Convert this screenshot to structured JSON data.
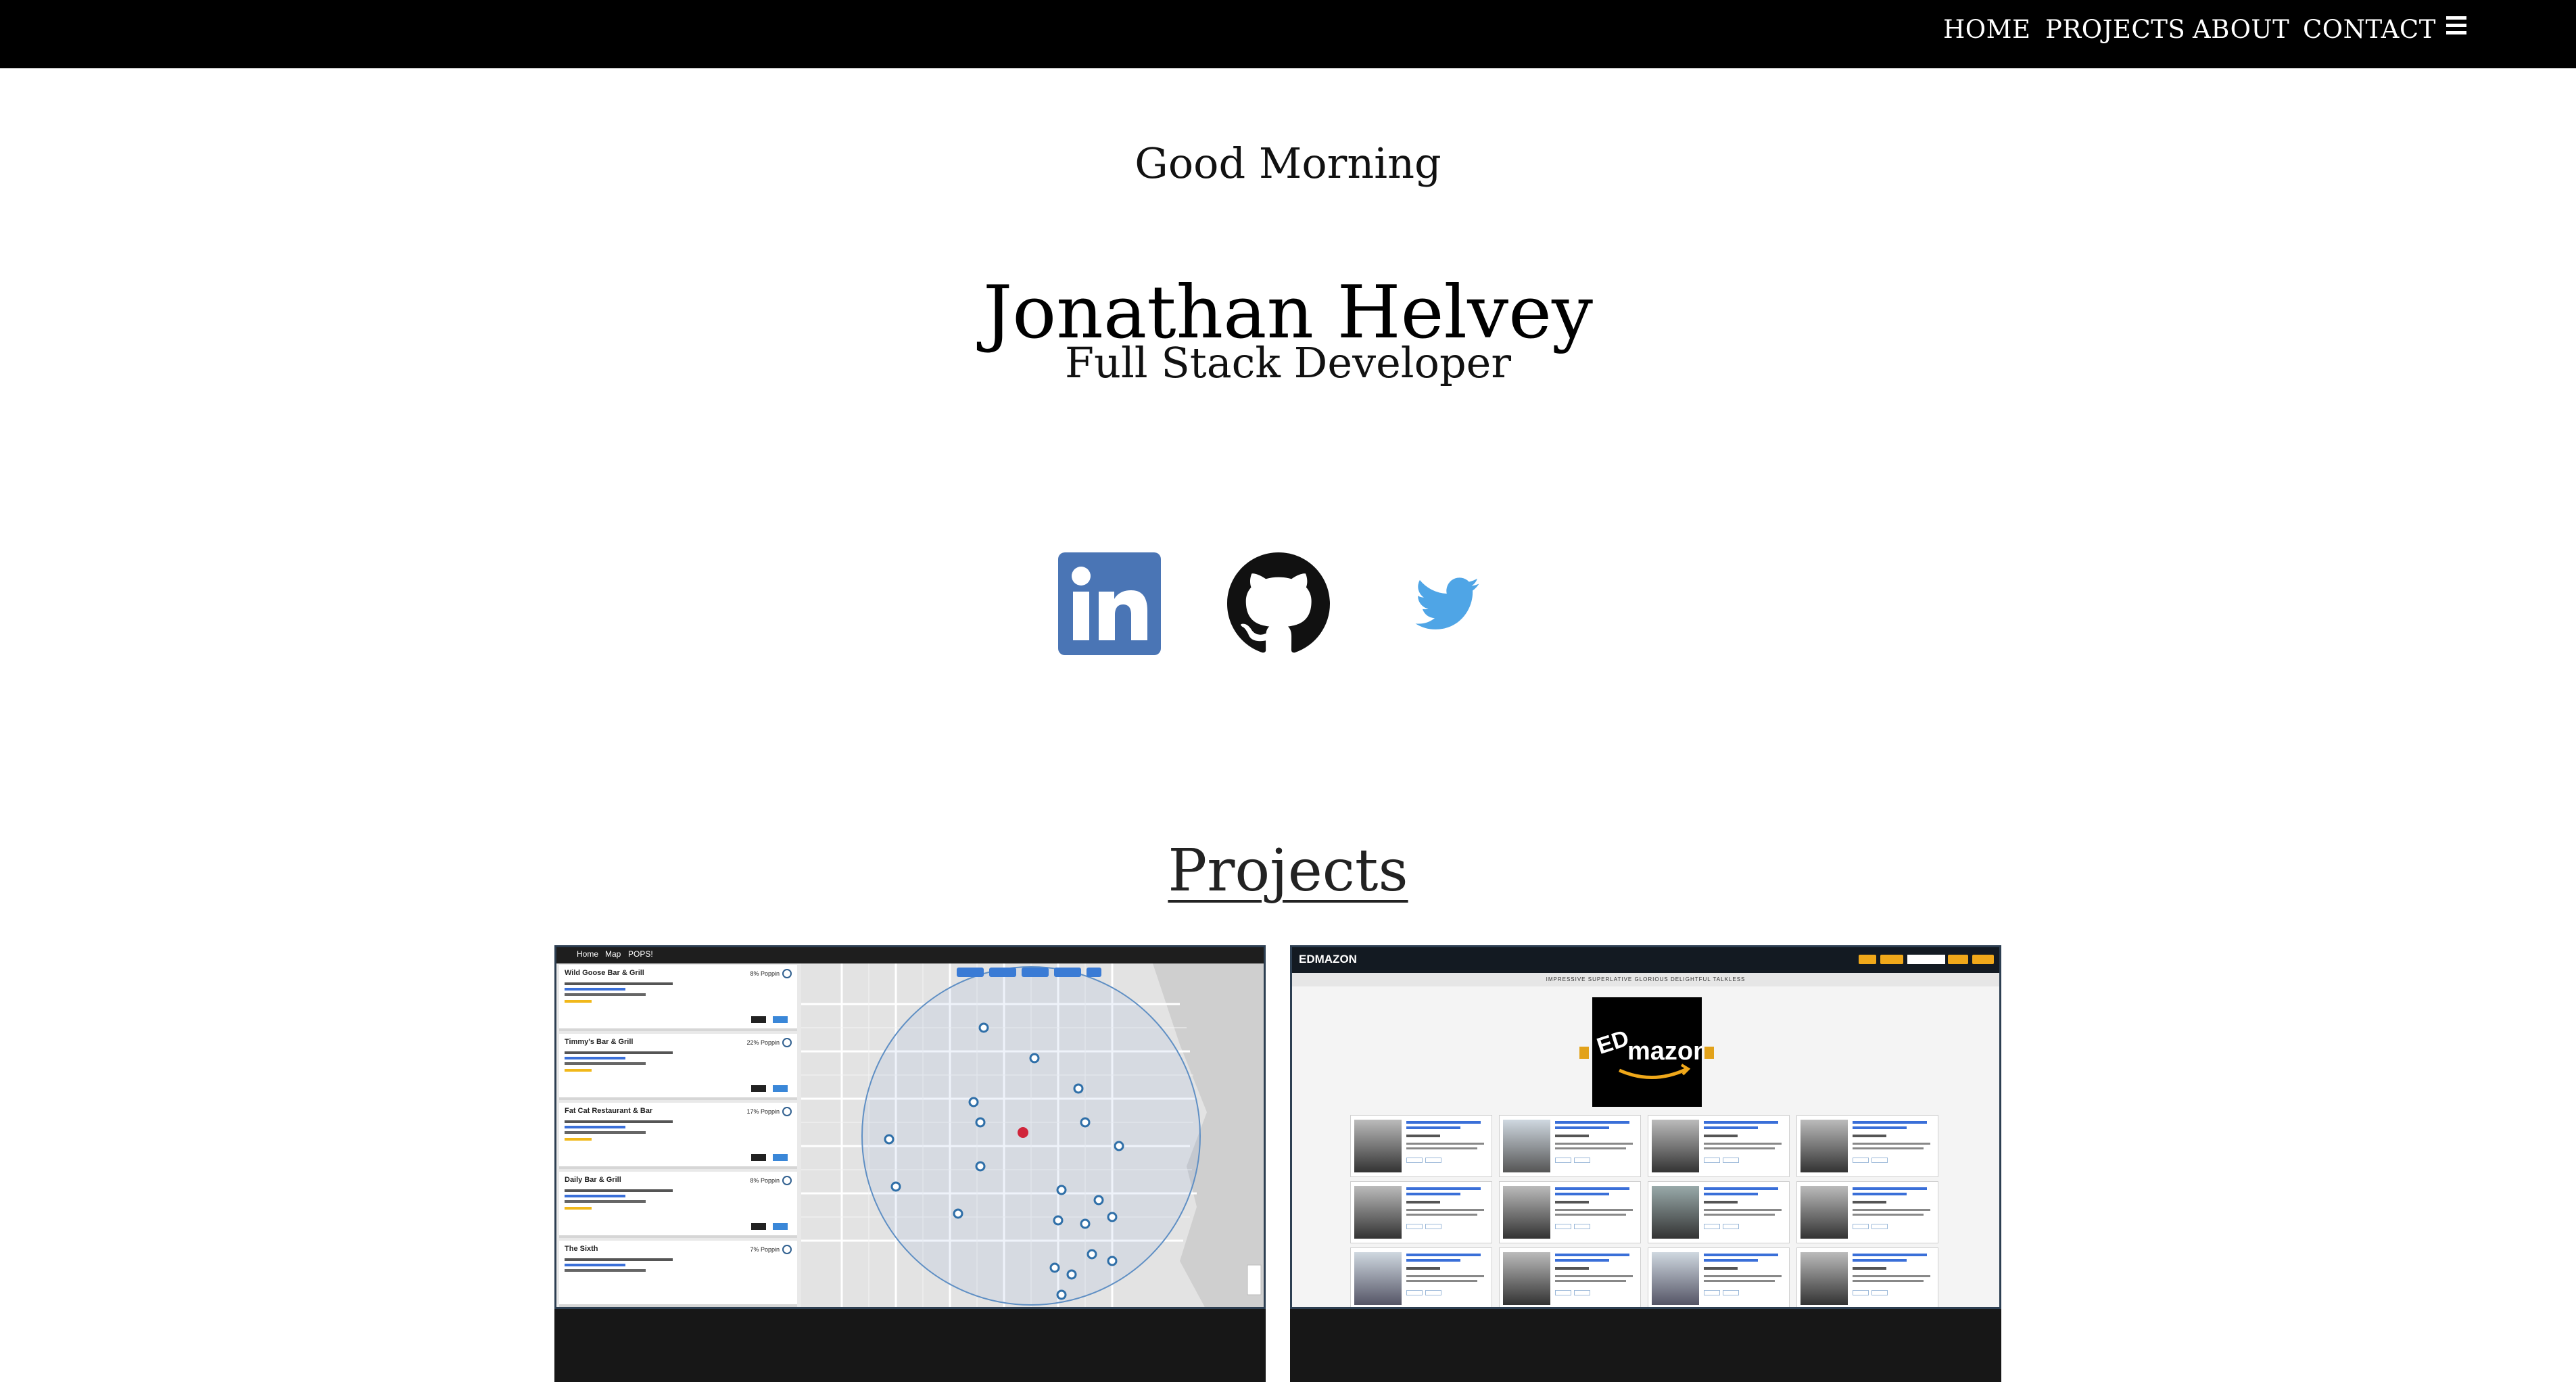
{
  "nav": {
    "links": [
      "HOME",
      "PROJECTS",
      "ABOUT",
      "CONTACT"
    ],
    "menu_icon": "hamburger-menu-icon"
  },
  "hero": {
    "greeting": "Good Morning",
    "name": "Jonathan Helvey",
    "title": "Full Stack Developer"
  },
  "social": [
    {
      "name": "linkedin-icon",
      "color": "#4a75b5"
    },
    {
      "name": "github-icon",
      "color": "#111111"
    },
    {
      "name": "twitter-icon",
      "color": "#4fa5e6"
    }
  ],
  "projects": {
    "heading": "Projects",
    "cards": [
      {
        "screenshot": "map-app",
        "app_nav": [
          "Home",
          "Map",
          "POPS!"
        ],
        "listings": [
          {
            "name": "Wild Goose Bar & Grill",
            "percent": "8% Poppin"
          },
          {
            "name": "Timmy's Bar & Grill",
            "percent": "22% Poppin"
          },
          {
            "name": "Fat Cat Restaurant & Bar",
            "percent": "17% Poppin"
          },
          {
            "name": "Daily Bar & Grill",
            "percent": "8% Poppin"
          },
          {
            "name": "The Sixth",
            "percent": "7% Poppin"
          }
        ]
      },
      {
        "screenshot": "edmazon-app",
        "brand": "EDMAZON",
        "categories": "IMPRESSIVE   SUPERLATIVE   GLORIOUS   DELIGHTFUL   TALKLESS"
      }
    ]
  },
  "colors": {
    "topbar": "#000000",
    "linkedin": "#4a75b5",
    "twitter": "#4fa5e6",
    "card_bg": "#171717"
  }
}
